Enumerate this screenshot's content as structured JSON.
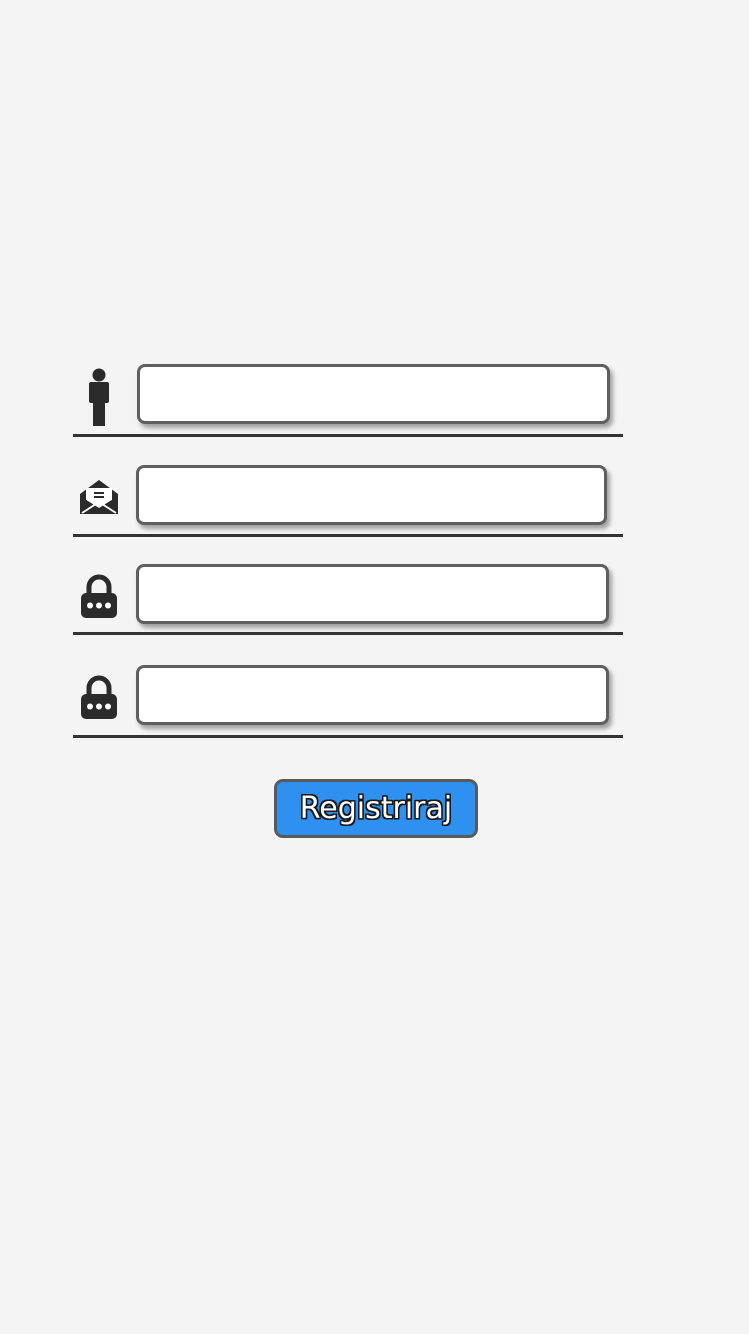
{
  "form": {
    "fields": [
      {
        "icon": "person-icon",
        "value": "",
        "placeholder": ""
      },
      {
        "icon": "envelope-icon",
        "value": "",
        "placeholder": ""
      },
      {
        "icon": "lock-icon",
        "value": "",
        "placeholder": ""
      },
      {
        "icon": "lock-icon",
        "value": "",
        "placeholder": ""
      }
    ],
    "submit_label": "Registriraj"
  },
  "colors": {
    "background": "#f4f4f4",
    "button": "#2e91f0",
    "icon": "#2b2b2b",
    "divider": "#333333"
  }
}
